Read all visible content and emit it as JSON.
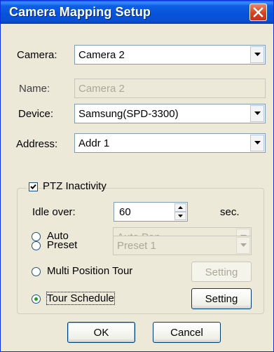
{
  "window": {
    "title": "Camera Mapping Setup"
  },
  "fields": {
    "camera": {
      "label": "Camera:",
      "value": "Camera 2"
    },
    "name": {
      "label": "Name:",
      "value": "Camera 2"
    },
    "device": {
      "label": "Device:",
      "value": "Samsung(SPD-3300)"
    },
    "address": {
      "label": "Address:",
      "value": "Addr 1"
    }
  },
  "ptz": {
    "caption": "PTZ Inactivity",
    "checked": true,
    "idle_label": "Idle over:",
    "idle_value": "60",
    "idle_unit": "sec.",
    "options": {
      "auto": {
        "label": "Auto",
        "value": "Auto Pan",
        "selected": false
      },
      "preset": {
        "label": "Preset",
        "value": "Preset 1",
        "selected": false
      },
      "multi": {
        "label": "Multi Position Tour",
        "button": "Setting",
        "selected": false
      },
      "tour": {
        "label": "Tour Schedule",
        "button": "Setting",
        "selected": true
      }
    }
  },
  "buttons": {
    "ok": "OK",
    "cancel": "Cancel"
  }
}
